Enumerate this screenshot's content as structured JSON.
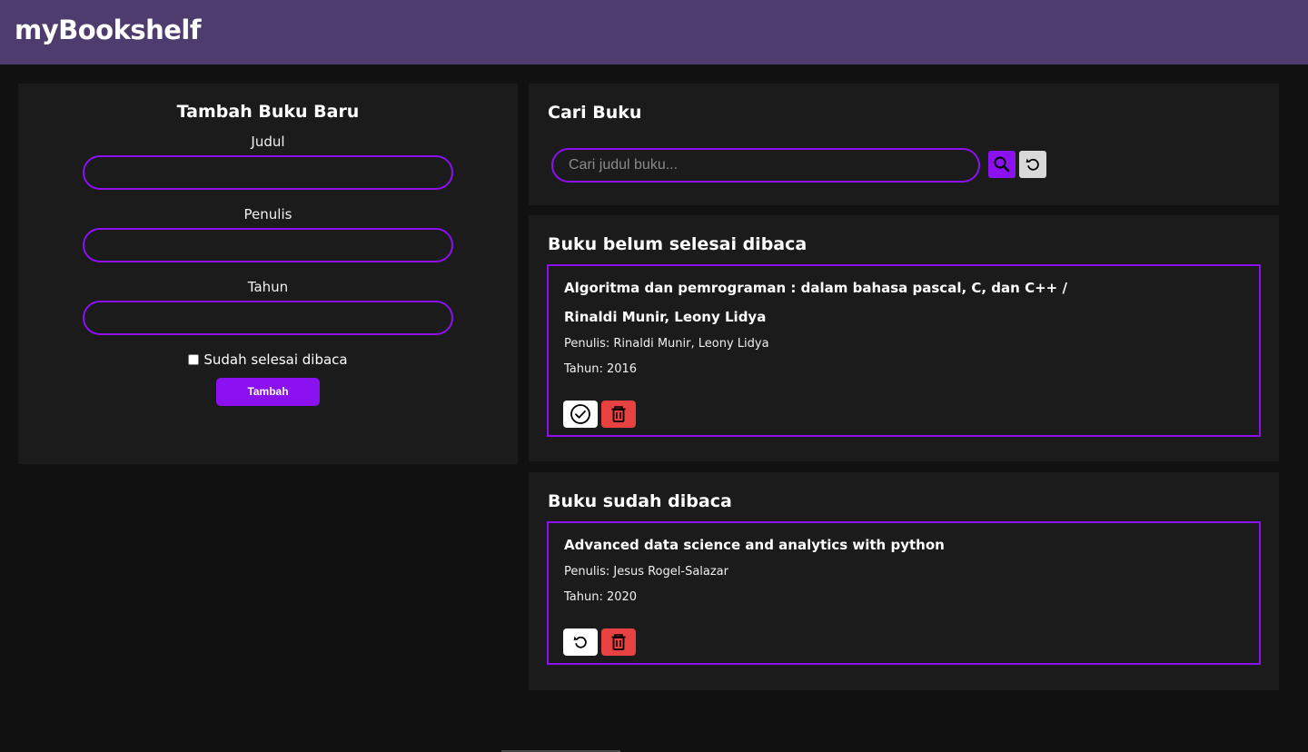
{
  "header": {
    "title": "myBookshelf"
  },
  "add_form": {
    "title": "Tambah Buku Baru",
    "title_label": "Judul",
    "title_value": "",
    "author_label": "Penulis",
    "author_value": "",
    "year_label": "Tahun",
    "year_value": "",
    "finished_label": "Sudah selesai dibaca",
    "finished_checked": false,
    "submit_label": "Tambah"
  },
  "search": {
    "title": "Cari Buku",
    "placeholder": "Cari judul buku...",
    "value": "",
    "search_icon": "search-icon",
    "reset_icon": "reset-icon"
  },
  "unread": {
    "title": "Buku belum selesai dibaca",
    "books": [
      {
        "title_line1": "Algoritma dan pemrograman : dalam bahasa pascal, C, dan C++ /",
        "title_line2": "Rinaldi Munir, Leony Lidya",
        "author": "Penulis: Rinaldi Munir, Leony Lidya",
        "year": "Tahun: 2016",
        "actions": [
          "check-circle-icon",
          "trash-icon"
        ]
      }
    ]
  },
  "read": {
    "title": "Buku sudah dibaca",
    "books": [
      {
        "title_line1": "Advanced data science and analytics with python",
        "author": "Penulis: Jesus Rogel-Salazar",
        "year": "Tahun: 2020",
        "actions": [
          "undo-icon",
          "trash-icon"
        ]
      }
    ]
  },
  "colors": {
    "accent": "#8c11f0",
    "header_bg": "#4f3c6e",
    "panel_bg": "#1b1b1c",
    "page_bg": "#111111",
    "danger": "#e84141"
  }
}
